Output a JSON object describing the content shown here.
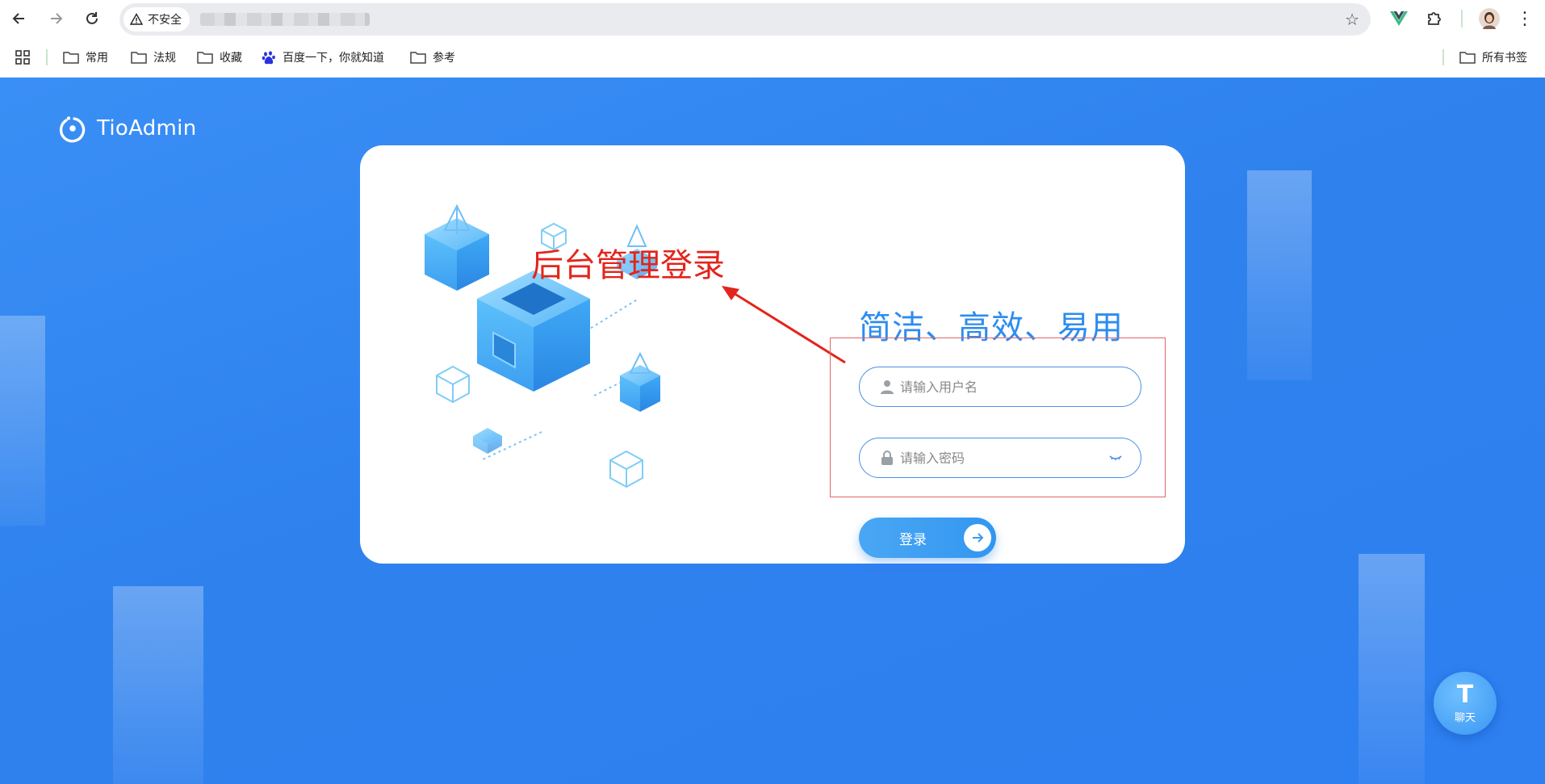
{
  "browser": {
    "security_label": "不安全",
    "bookmarks": [
      "常用",
      "法规",
      "收藏",
      "百度一下，你就知道",
      "参考"
    ],
    "all_bookmarks_label": "所有书签"
  },
  "page": {
    "brand": "TioAdmin",
    "annotation_title": "后台管理登录",
    "slogan": "简洁、高效、易用",
    "username_placeholder": "请输入用户名",
    "password_placeholder": "请输入密码",
    "login_label": "登录",
    "chat_label": "聊天",
    "chat_logo": "T"
  },
  "colors": {
    "background": "#2f82ee",
    "accent": "#2d8cf0",
    "annotation": "#e3251c"
  }
}
